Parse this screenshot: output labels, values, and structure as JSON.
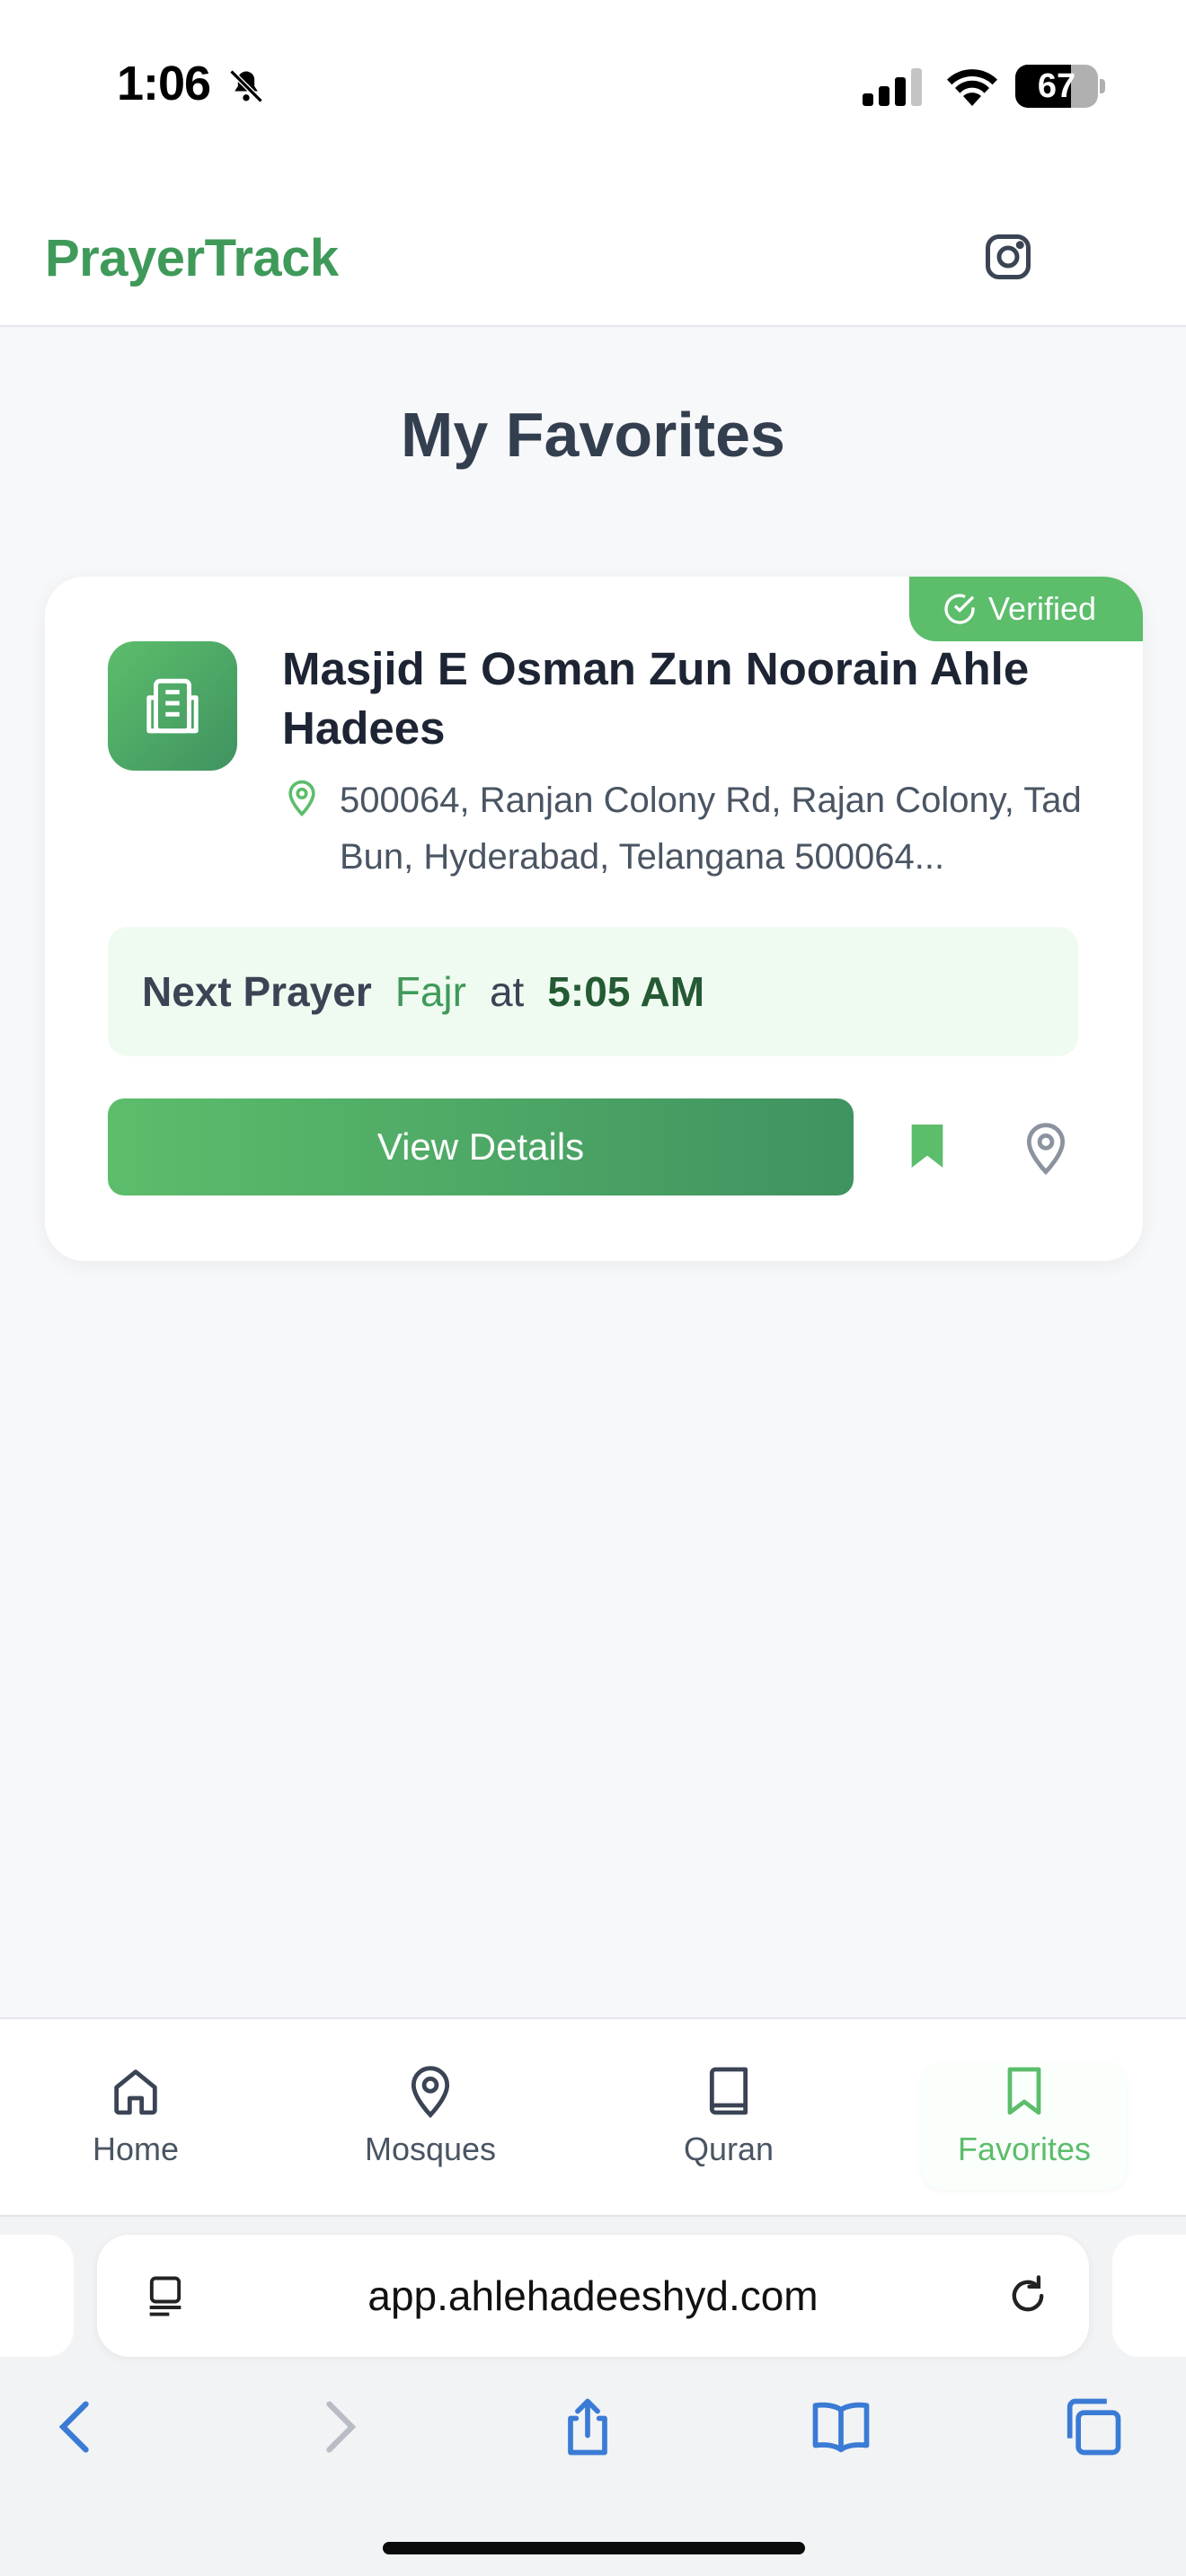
{
  "status_bar": {
    "time": "1:06",
    "battery": "67",
    "battery_level": 0.67
  },
  "header": {
    "brand": "PrayerTrack",
    "social_icon": "instagram-icon"
  },
  "page": {
    "title": "My Favorites"
  },
  "favorites": [
    {
      "badge": "Verified",
      "name": "Masjid E Osman Zun Noorain Ahle Hadees",
      "address": "500064, Ranjan Colony Rd, Rajan Colony, Tad Bun, Hyderabad, Telangana 500064...",
      "next_prayer_label": "Next Prayer",
      "next_prayer_name": "Fajr",
      "next_prayer_at": "at",
      "next_prayer_time": "5:05 AM",
      "view_details_label": "View Details"
    }
  ],
  "nav": [
    {
      "label": "Home",
      "icon": "home-icon"
    },
    {
      "label": "Mosques",
      "icon": "map-pin-icon"
    },
    {
      "label": "Quran",
      "icon": "book-icon"
    },
    {
      "label": "Favorites",
      "icon": "bookmark-icon",
      "active": true
    }
  ],
  "browser": {
    "url": "app.ahlehadeeshyd.com"
  },
  "colors": {
    "brand_green": "#3f9a5a",
    "accent_green": "#5cbd6b",
    "ios_blue": "#3a7bd5"
  }
}
